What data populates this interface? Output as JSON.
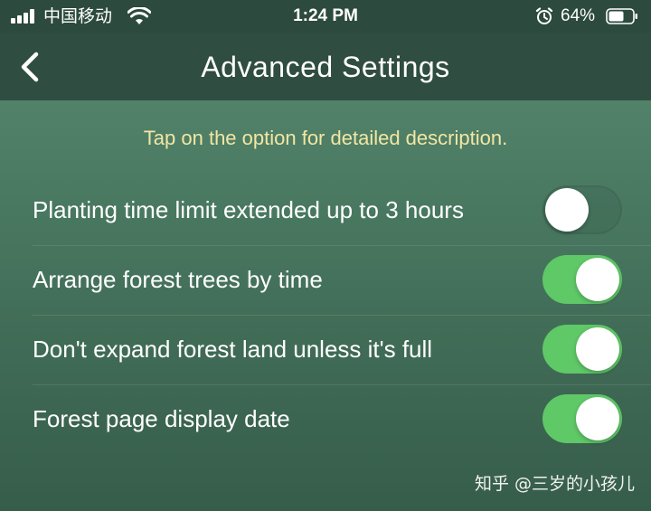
{
  "status_bar": {
    "carrier": "中国移动",
    "time": "1:24 PM",
    "battery_percent": "64%",
    "battery_level": 0.64,
    "icons": [
      "signal-icon",
      "wifi-icon",
      "alarm-icon",
      "battery-icon"
    ]
  },
  "nav": {
    "title": "Advanced Settings",
    "back_icon": "chevron-left-icon"
  },
  "hint": "Tap on the option for detailed description.",
  "settings": [
    {
      "label": "Planting time limit extended up to 3 hours",
      "enabled": false
    },
    {
      "label": "Arrange forest trees by time",
      "enabled": true
    },
    {
      "label": "Don't expand forest land unless it's full",
      "enabled": true
    },
    {
      "label": "Forest page display date",
      "enabled": true
    }
  ],
  "watermark": "知乎 @三岁的小孩儿",
  "colors": {
    "toggle_on": "#5fc867",
    "hint_text": "#f3e6a3",
    "nav_background": "#2f4d40"
  }
}
